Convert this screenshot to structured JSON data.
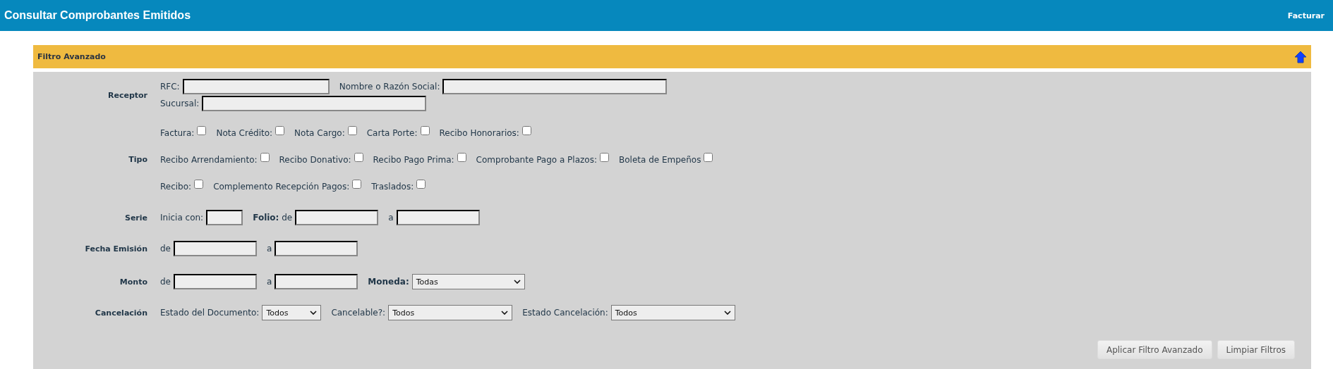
{
  "header": {
    "title": "Consultar Comprobantes Emitidos",
    "link": "Facturar"
  },
  "filter": {
    "title": "Filtro Avanzado",
    "expanded": true,
    "rows": [
      {
        "label": "Receptor",
        "lines": [
          [
            {
              "kind": "medium-input",
              "label": "RFC:"
            },
            {
              "kind": "wide-input",
              "label": "Nombre o Razón Social:"
            }
          ],
          [
            {
              "kind": "wide-input",
              "label": "Sucursal:"
            }
          ]
        ]
      },
      {
        "label": "Tipo",
        "lines": [
          [
            {
              "kind": "checkbox",
              "label": "Factura:",
              "checked": false
            },
            {
              "kind": "checkbox",
              "label": "Nota Crédito:",
              "checked": false
            },
            {
              "kind": "checkbox",
              "label": "Nota Cargo:",
              "checked": false
            },
            {
              "kind": "checkbox",
              "label": "Carta Porte:",
              "checked": false
            },
            {
              "kind": "checkbox",
              "label": "Recibo Honorarios:",
              "checked": false
            }
          ],
          [
            {
              "kind": "checkbox",
              "label": "Recibo Arrendamiento:",
              "checked": false
            },
            {
              "kind": "checkbox",
              "label": "Recibo Donativo:",
              "checked": false
            },
            {
              "kind": "checkbox",
              "label": "Recibo Pago Prima:",
              "checked": false
            },
            {
              "kind": "checkbox",
              "label": "Comprobante Pago a Plazos:",
              "checked": false
            },
            {
              "kind": "checkbox",
              "label": "Boleta de Empeños",
              "checked": false
            }
          ],
          [
            {
              "kind": "checkbox",
              "label": "Recibo:",
              "checked": false
            },
            {
              "kind": "checkbox",
              "label": "Complemento Recepción Pagos:",
              "checked": false
            },
            {
              "kind": "checkbox",
              "label": "Traslados:",
              "checked": false
            }
          ]
        ]
      },
      {
        "label": "Serie",
        "lines": [
          [
            {
              "kind": "short-input",
              "label": "Inicia con:"
            },
            {
              "kind": "input",
              "label": "**Folio:** de"
            },
            {
              "kind": "input",
              "label": "a"
            }
          ]
        ]
      },
      {
        "label": "Fecha Emisión",
        "lines": [
          [
            {
              "kind": "input",
              "label": "de"
            },
            {
              "kind": "input",
              "label": "a"
            }
          ]
        ]
      },
      {
        "label": "Monto",
        "lines": [
          [
            {
              "kind": "input",
              "label": "de"
            },
            {
              "kind": "input",
              "label": "a"
            },
            {
              "kind": "select",
              "label": "Moneda:",
              "bold": true,
              "value": "Todas"
            }
          ]
        ]
      },
      {
        "label": "Cancelación",
        "lines": [
          [
            {
              "kind": "short-select",
              "label": "Estado del Documento:",
              "value": "Todos"
            },
            {
              "kind": "wide-select",
              "label": "Cancelable?:",
              "value": "Todos"
            },
            {
              "kind": "wide-select",
              "label": "Estado Cancelación:",
              "value": "Todos"
            }
          ]
        ]
      }
    ],
    "buttons": [
      "Aplicar Filtro Avanzado",
      "Limpiar Filtros"
    ]
  }
}
